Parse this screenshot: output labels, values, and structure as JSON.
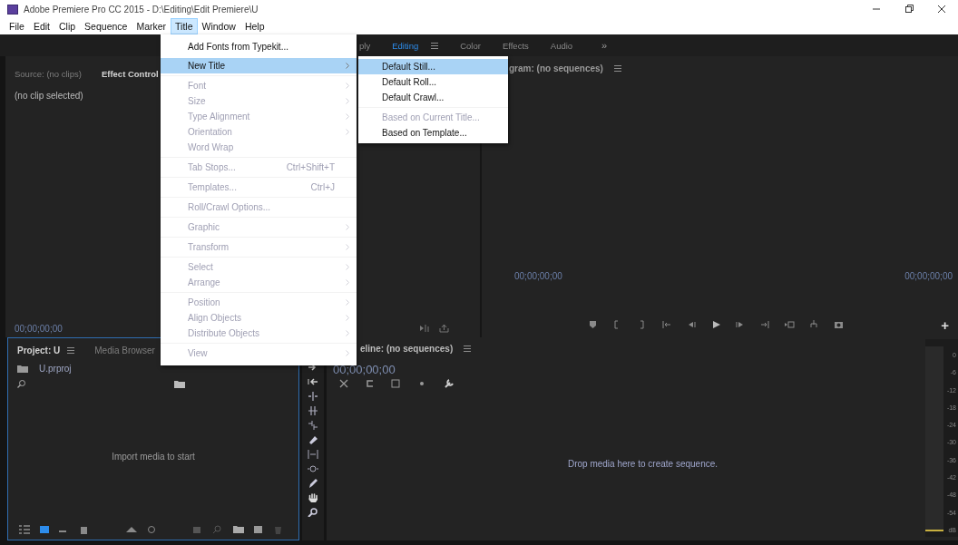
{
  "window": {
    "title": "Adobe Premiere Pro CC 2015 - D:\\Editing\\Edit Premiere\\U"
  },
  "menu_bar": [
    {
      "label": "File",
      "selected": false
    },
    {
      "label": "Edit",
      "selected": false
    },
    {
      "label": "Clip",
      "selected": false
    },
    {
      "label": "Sequence",
      "selected": false
    },
    {
      "label": "Marker",
      "selected": false
    },
    {
      "label": "Title",
      "selected": true
    },
    {
      "label": "Window",
      "selected": false
    },
    {
      "label": "Help",
      "selected": false
    }
  ],
  "title_menu": {
    "groups": [
      [
        {
          "label": "Add Fonts from Typekit...",
          "disabled": false,
          "selected": false,
          "has_submenu": false
        }
      ],
      [
        {
          "label": "New Title",
          "disabled": false,
          "selected": true,
          "has_submenu": true,
          "submenu": [
            [
              {
                "label": "Default Still...",
                "disabled": false,
                "selected": true
              },
              {
                "label": "Default Roll...",
                "disabled": false,
                "selected": false
              },
              {
                "label": "Default Crawl...",
                "disabled": false,
                "selected": false
              }
            ],
            [
              {
                "label": "Based on Current Title...",
                "disabled": true,
                "selected": false
              },
              {
                "label": "Based on Template...",
                "disabled": false,
                "selected": false
              }
            ]
          ]
        }
      ],
      [
        {
          "label": "Font",
          "disabled": true,
          "selected": false,
          "has_submenu": true
        },
        {
          "label": "Size",
          "disabled": true,
          "selected": false,
          "has_submenu": true
        },
        {
          "label": "Type Alignment",
          "disabled": true,
          "selected": false,
          "has_submenu": true
        },
        {
          "label": "Orientation",
          "disabled": true,
          "selected": false,
          "has_submenu": true
        },
        {
          "label": "Word Wrap",
          "disabled": true,
          "selected": false,
          "has_submenu": false
        }
      ],
      [
        {
          "label": "Tab Stops...",
          "disabled": true,
          "selected": false,
          "has_submenu": false,
          "shortcut": "Ctrl+Shift+T"
        }
      ],
      [
        {
          "label": "Templates...",
          "disabled": true,
          "selected": false,
          "has_submenu": false,
          "shortcut": "Ctrl+J"
        }
      ],
      [
        {
          "label": "Roll/Crawl Options...",
          "disabled": true,
          "selected": false,
          "has_submenu": false
        }
      ],
      [
        {
          "label": "Graphic",
          "disabled": true,
          "selected": false,
          "has_submenu": true
        }
      ],
      [
        {
          "label": "Transform",
          "disabled": true,
          "selected": false,
          "has_submenu": true
        }
      ],
      [
        {
          "label": "Select",
          "disabled": true,
          "selected": false,
          "has_submenu": true
        },
        {
          "label": "Arrange",
          "disabled": true,
          "selected": false,
          "has_submenu": true
        }
      ],
      [
        {
          "label": "Position",
          "disabled": true,
          "selected": false,
          "has_submenu": true
        },
        {
          "label": "Align Objects",
          "disabled": true,
          "selected": false,
          "has_submenu": true
        },
        {
          "label": "Distribute Objects",
          "disabled": true,
          "selected": false,
          "has_submenu": true
        }
      ],
      [
        {
          "label": "View",
          "disabled": true,
          "selected": false,
          "has_submenu": true
        }
      ]
    ]
  },
  "workspaces": {
    "tabs": [
      {
        "label": "ply",
        "selected": false
      },
      {
        "label": "Editing",
        "selected": true
      },
      {
        "label": "Color",
        "selected": false
      },
      {
        "label": "Effects",
        "selected": false
      },
      {
        "label": "Audio",
        "selected": false
      }
    ],
    "overflow": "»"
  },
  "source_panel": {
    "tabs": [
      {
        "label": "Source: (no clips)",
        "selected": false
      },
      {
        "label": "Effect Control",
        "selected": true
      }
    ],
    "message": "(no clip selected)",
    "timecode": "00;00;00;00"
  },
  "program_panel": {
    "title": "gram: (no sequences)",
    "timecode_left": "00;00;00;00",
    "timecode_right": "00;00;00;00",
    "add_button": "+"
  },
  "project_panel": {
    "tabs": [
      {
        "label": "Project: U",
        "selected": true
      },
      {
        "label": "Media Browser",
        "selected": false
      }
    ],
    "file": "U.prproj",
    "message": "Import media to start"
  },
  "timeline_panel": {
    "title": "eline: (no sequences)",
    "timecode": "00;00;00;00",
    "message": "Drop media here to create sequence.",
    "meter_scale": [
      "0",
      "-6",
      "-12",
      "-18",
      "-24",
      "-30",
      "-36",
      "-42",
      "-48",
      "-54",
      "dB"
    ]
  }
}
